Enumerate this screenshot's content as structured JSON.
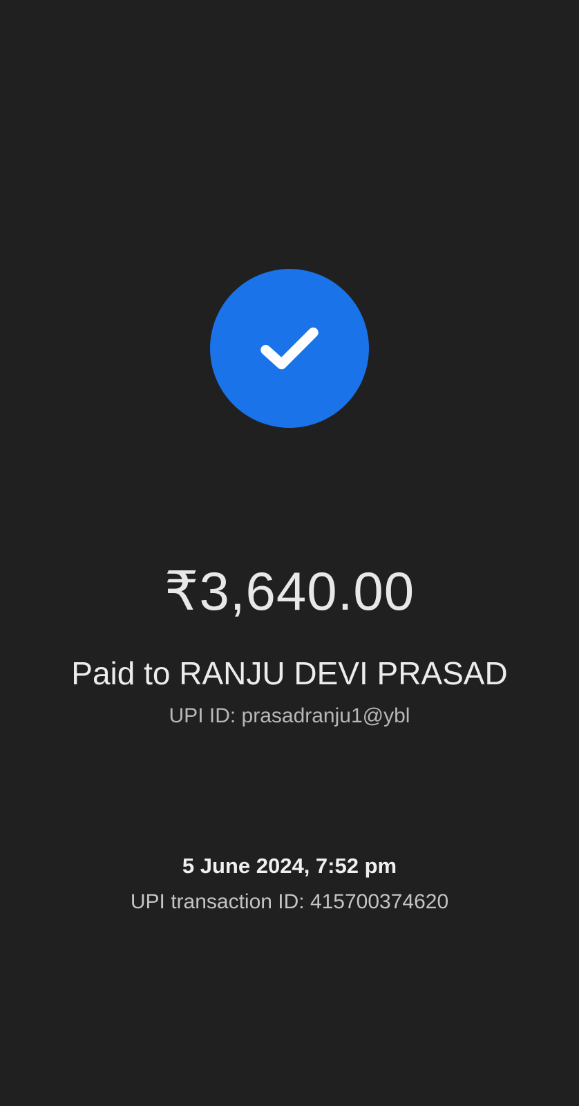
{
  "status": {
    "icon": "check-circle-icon",
    "color": "#1a73e8"
  },
  "payment": {
    "amount": "₹3,640.00",
    "payee_label": "Paid to RANJU DEVI PRASAD",
    "upi_id_label": "UPI ID: prasadranju1@ybl"
  },
  "transaction": {
    "datetime": "5 June 2024, 7:52 pm",
    "id_label": "UPI transaction ID: 415700374620"
  }
}
